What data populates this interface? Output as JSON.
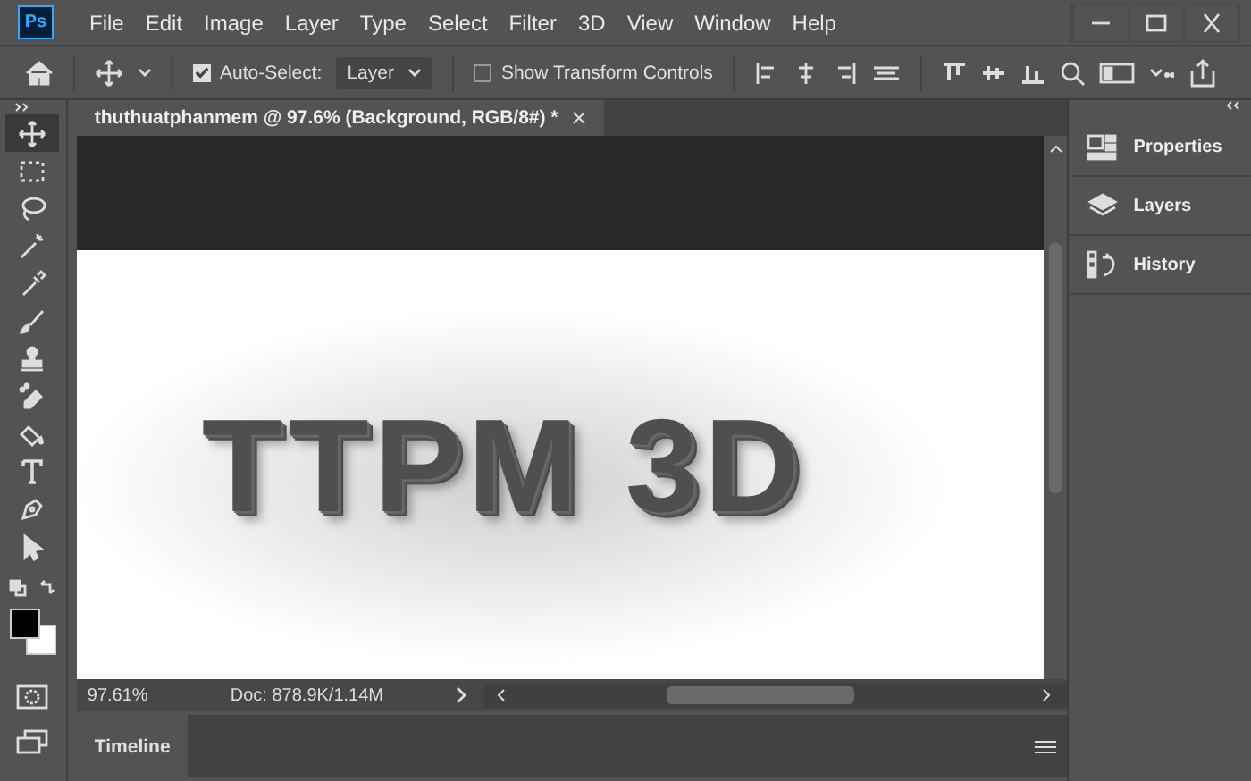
{
  "app_logo": "Ps",
  "menu": [
    "File",
    "Edit",
    "Image",
    "Layer",
    "Type",
    "Select",
    "Filter",
    "3D",
    "View",
    "Window",
    "Help"
  ],
  "options_bar": {
    "auto_select": {
      "label": "Auto-Select:",
      "checked": true
    },
    "target": {
      "value": "Layer"
    },
    "transform_controls": {
      "label": "Show Transform Controls",
      "checked": false
    }
  },
  "tools": [
    {
      "kind": "move",
      "selected": true
    },
    {
      "kind": "marquee",
      "selected": false
    },
    {
      "kind": "lasso",
      "selected": false
    },
    {
      "kind": "wand",
      "selected": false
    },
    {
      "kind": "eyedropper",
      "selected": false
    },
    {
      "kind": "brush",
      "selected": false
    },
    {
      "kind": "stamp",
      "selected": false
    },
    {
      "kind": "eraser",
      "selected": false
    },
    {
      "kind": "bucket",
      "selected": false
    },
    {
      "kind": "type",
      "selected": false
    },
    {
      "kind": "pen",
      "selected": false
    },
    {
      "kind": "arrow",
      "selected": false
    }
  ],
  "document_tab": {
    "title": "thuthuatphanmem @ 97.6% (Background, RGB/8#) *"
  },
  "canvas": {
    "text": "TTPM 3D"
  },
  "status_bar": {
    "zoom": "97.61%",
    "doc_size": "Doc: 878.9K/1.14M"
  },
  "timeline": {
    "label": "Timeline"
  },
  "panels": [
    {
      "kind": "properties",
      "label": "Properties"
    },
    {
      "kind": "layers",
      "label": "Layers"
    },
    {
      "kind": "history",
      "label": "History"
    }
  ]
}
